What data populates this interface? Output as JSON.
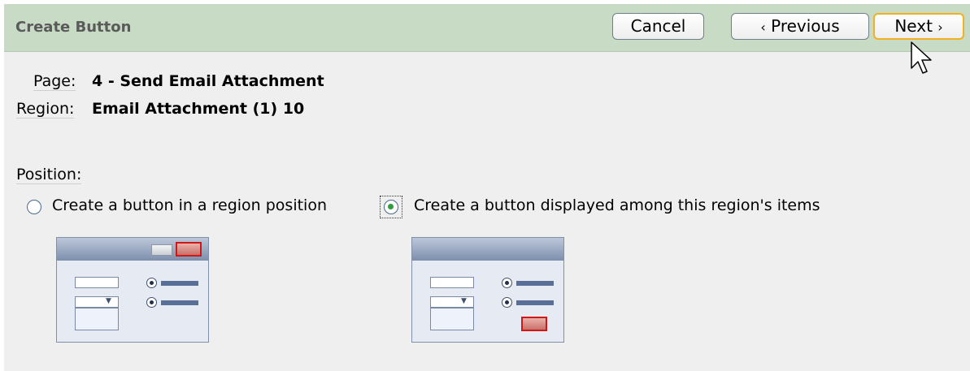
{
  "header": {
    "title": "Create Button",
    "cancel_label": "Cancel",
    "previous_label": "Previous",
    "next_label": "Next"
  },
  "info": {
    "page_label": "Page:",
    "page_value": "4 - Send Email Attachment",
    "region_label": "Region:",
    "region_value": "Email Attachment (1) 10"
  },
  "position": {
    "label": "Position:",
    "options": [
      {
        "label": "Create a button in a region position",
        "selected": false
      },
      {
        "label": "Create a button displayed among this region's items",
        "selected": true
      }
    ]
  },
  "colors": {
    "header_bg": "#c8dcc5",
    "content_bg": "#efefef",
    "focus_border": "#f0b020",
    "selected_radio": "#2d9e3a"
  },
  "icons": [
    "chevron-left-icon",
    "chevron-right-icon",
    "mouse-cursor-icon"
  ]
}
